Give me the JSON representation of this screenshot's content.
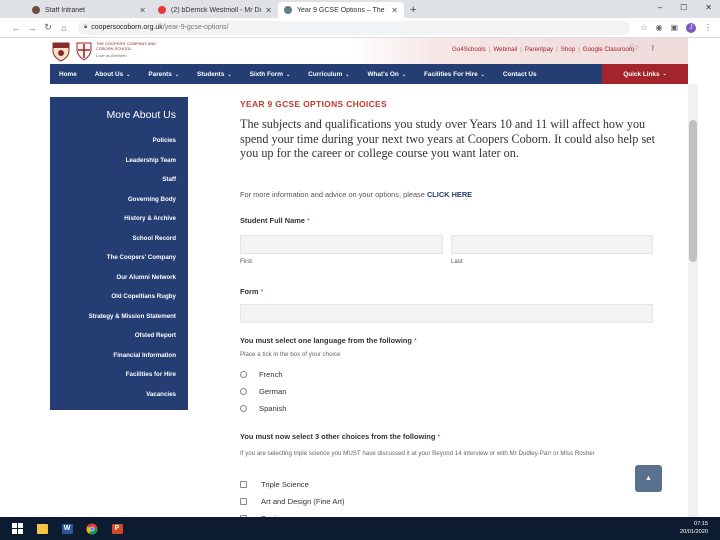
{
  "browser": {
    "tabs": [
      {
        "title": "Staff Intranet",
        "favicon_color": "#6d4c41",
        "active": false
      },
      {
        "title": "(2) bDerrick Westmoll - Mr Dud",
        "favicon_color": "#e53935",
        "active": false
      },
      {
        "title": "Year 9 GCSE Options – The Coop",
        "favicon_color": "#607d8b",
        "active": true
      }
    ],
    "new_tab_glyph": "+",
    "window_controls": [
      "–",
      "☐",
      "✕"
    ],
    "url_host": "coopersocoborn.org.uk",
    "url_path": "/year-9-gcse-options/",
    "profile_letter": "J"
  },
  "site": {
    "school_name": "THE COOPERS' COMPANY AND COBORN SCHOOL",
    "motto": "Love as Brethren",
    "top_links": [
      "Go4Schools",
      "Webmail",
      "Parentpay",
      "Shop",
      "Google Classroom"
    ],
    "nav": [
      {
        "label": "Home",
        "has_menu": false
      },
      {
        "label": "About Us",
        "has_menu": true
      },
      {
        "label": "Parents",
        "has_menu": true
      },
      {
        "label": "Students",
        "has_menu": true
      },
      {
        "label": "Sixth Form",
        "has_menu": true
      },
      {
        "label": "Curriculum",
        "has_menu": true
      },
      {
        "label": "What's On",
        "has_menu": true
      },
      {
        "label": "Facilities For Hire",
        "has_menu": true
      },
      {
        "label": "Contact Us",
        "has_menu": false
      }
    ],
    "quick_links": "Quick Links",
    "colors": {
      "navy": "#243d73",
      "red": "#a3242b",
      "title_red": "#c0392b"
    }
  },
  "sidebar": {
    "heading": "More About Us",
    "items": [
      "Policies",
      "Leadership Team",
      "Staff",
      "Governing Body",
      "History & Archive",
      "School Record",
      "The Coopers' Company",
      "Our Alumni Network",
      "Old Copeltians Rugby",
      "Strategy & Mission Statement",
      "Ofsted Report",
      "Financial Information",
      "Facilities for Hire",
      "Vacancies"
    ]
  },
  "main": {
    "title": "YEAR 9 GCSE OPTIONS CHOICES",
    "intro": "The subjects and qualifications you study over Years 10 and 11 will affect how you spend your time during your next two years at Coopers Coborn. It could also help set you up for the career or college course you want later on.",
    "more_info_text": "For more information and advice on your options, please",
    "more_info_link": "CLICK HERE",
    "student_label": "Student Full Name",
    "first_label": "First",
    "last_label": "Last",
    "form_label": "Form",
    "language_label": "You must select one language from the following",
    "language_hint": "Place a tick in the box of your choice",
    "languages": [
      "French",
      "German",
      "Spanish"
    ],
    "other_label": "You must now select 3 other choices from the following",
    "other_hint": "If you are selecting triple science you MUST have discussed it at your Beyond 14 interview or with Mr Dudley-Parr or Miss Rosher",
    "other_options": [
      "Triple Science",
      "Art and Design (Fine Art)",
      "Business"
    ],
    "required_mark": "*"
  },
  "back_to_top": "▲",
  "taskbar": {
    "apps": [
      {
        "name": "windows-start",
        "color": "#ffffff"
      },
      {
        "name": "file-explorer",
        "color": "#f6c344"
      },
      {
        "name": "word",
        "color": "#2b579a"
      },
      {
        "name": "chrome",
        "color": "#e8b100"
      },
      {
        "name": "powerpoint",
        "color": "#d24726"
      }
    ],
    "time": "07:15",
    "date": "20/01/2020"
  }
}
